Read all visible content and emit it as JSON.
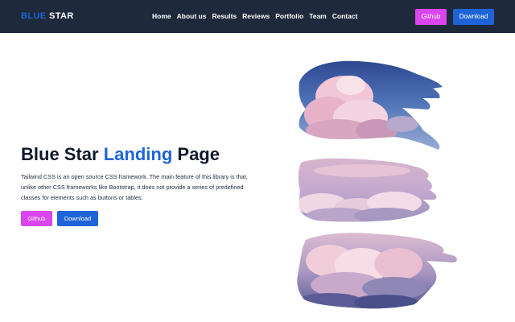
{
  "navbar": {
    "logo_part1": "Blue",
    "logo_part2": "Star",
    "links": [
      {
        "label": "Home"
      },
      {
        "label": "About us"
      },
      {
        "label": "Results"
      },
      {
        "label": "Reviews"
      },
      {
        "label": "Portfolio"
      },
      {
        "label": "Team"
      },
      {
        "label": "Contact"
      }
    ],
    "github_label": "Github",
    "download_label": "Download"
  },
  "hero": {
    "title_part1": "Blue Star",
    "title_accent": "Landing",
    "title_part2": "Page",
    "description": "Tailwind CSS is an open source CSS framework. The main feature of this library is that, unlike other CSS frameworks like Bootstrap, it does not provide a series of predefined classes for elements such as buttons or tables.",
    "github_label": "Github",
    "download_label": "Download"
  },
  "colors": {
    "navbar_bg": "#1e293b",
    "brand_blue": "#1d64d8",
    "github_pink": "#d946ef",
    "text_dark": "#0f172a"
  },
  "icons": {
    "hero_image": "cloud-brush-stroke-image"
  }
}
